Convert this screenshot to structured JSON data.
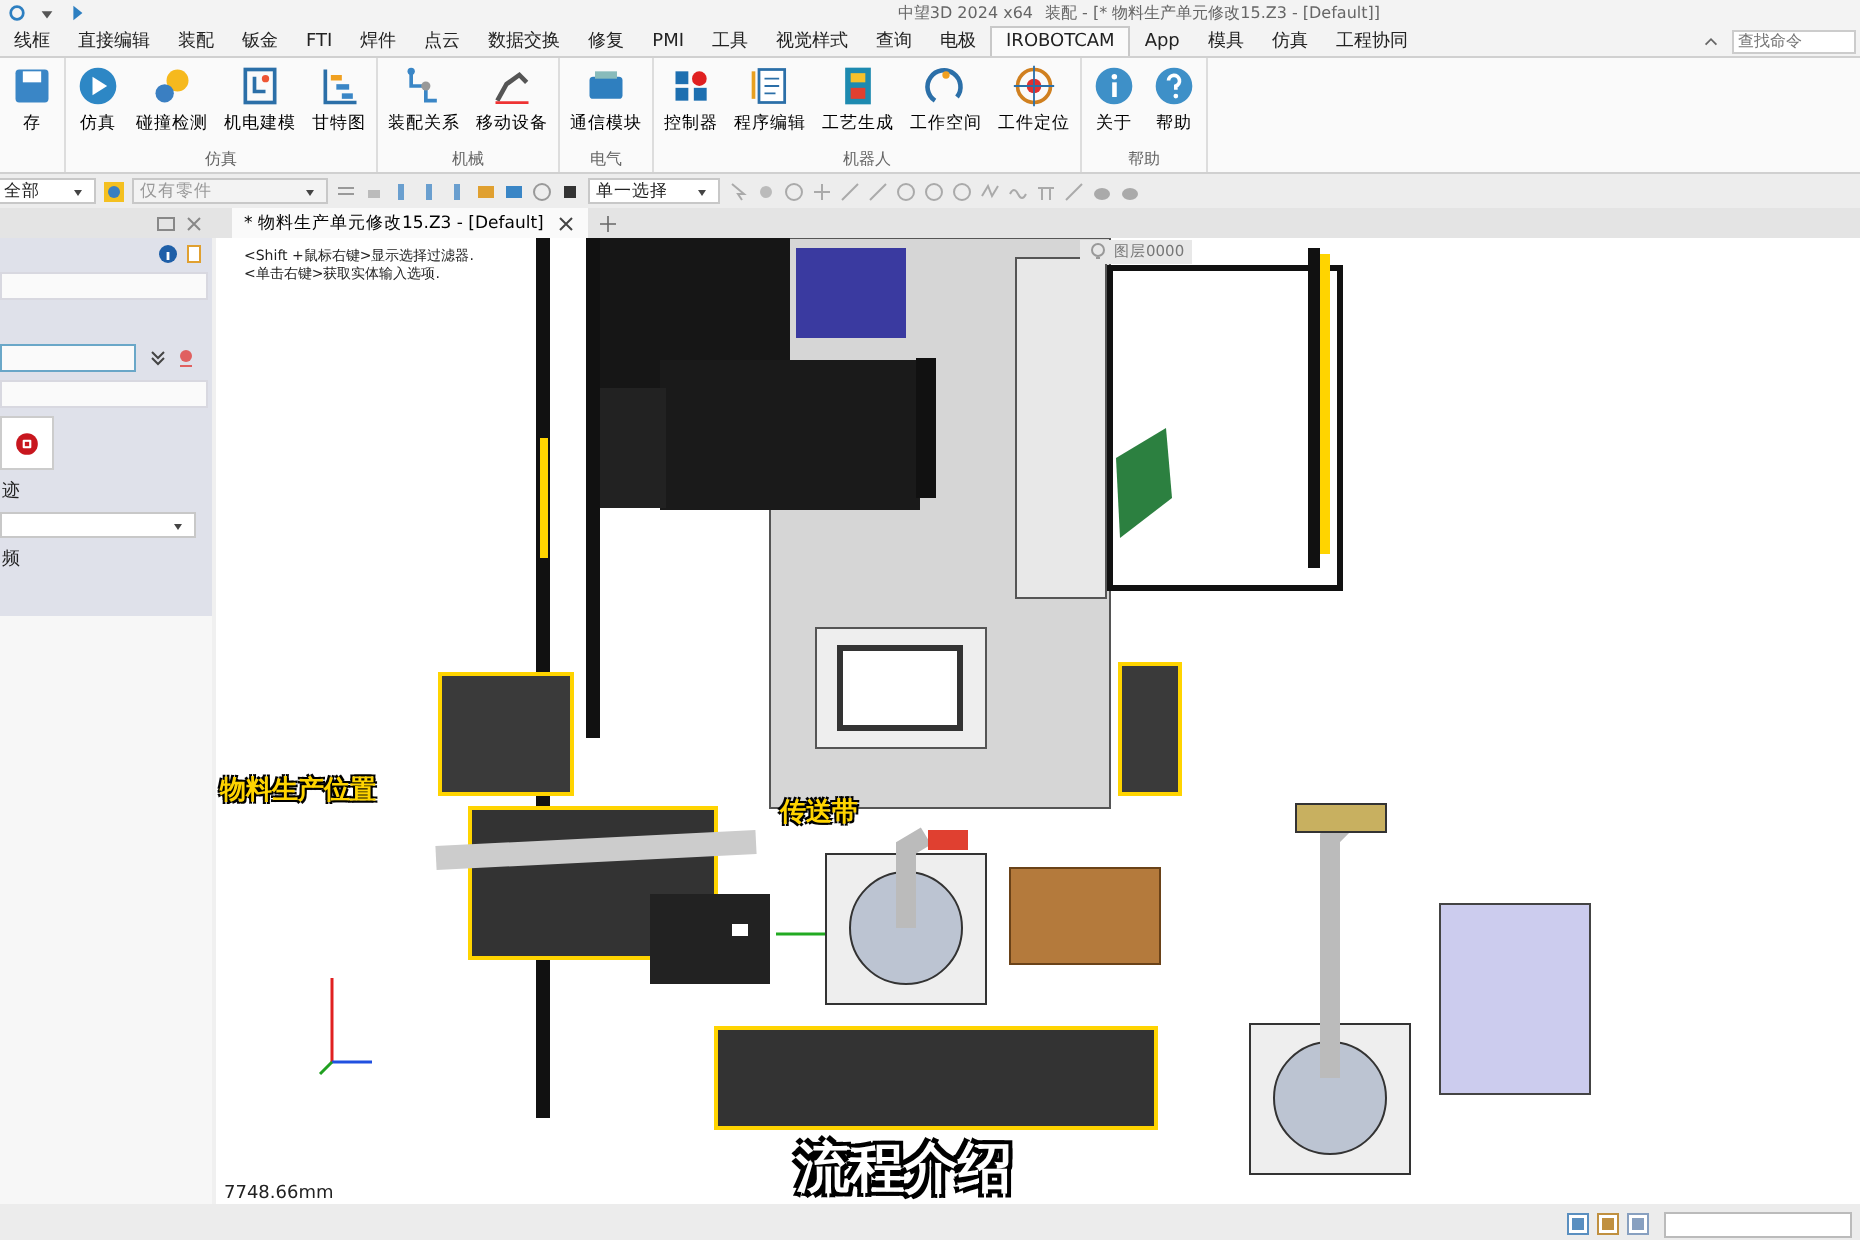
{
  "title_bar": {
    "app": "中望3D 2024 x64",
    "document": "装配 - [* 物料生产单元修改15.Z3 - [Default]]"
  },
  "menu_tabs": [
    {
      "label": "线框",
      "selected": false
    },
    {
      "label": "直接编辑",
      "selected": false
    },
    {
      "label": "装配",
      "selected": false
    },
    {
      "label": "钣金",
      "selected": false
    },
    {
      "label": "FTI",
      "selected": false
    },
    {
      "label": "焊件",
      "selected": false
    },
    {
      "label": "点云",
      "selected": false
    },
    {
      "label": "数据交换",
      "selected": false
    },
    {
      "label": "修复",
      "selected": false
    },
    {
      "label": "PMI",
      "selected": false
    },
    {
      "label": "工具",
      "selected": false
    },
    {
      "label": "视觉样式",
      "selected": false
    },
    {
      "label": "查询",
      "selected": false
    },
    {
      "label": "电极",
      "selected": false
    },
    {
      "label": "IROBOTCAM",
      "selected": true
    },
    {
      "label": "App",
      "selected": false
    },
    {
      "label": "模具",
      "selected": false
    },
    {
      "label": "仿真",
      "selected": false
    },
    {
      "label": "工程协同",
      "selected": false
    }
  ],
  "search": {
    "placeholder": "查找命令"
  },
  "ribbon": [
    {
      "items": [
        "存"
      ]
    },
    {
      "label": "仿真",
      "items": [
        "仿真",
        "碰撞检测",
        "机电建模",
        "甘特图"
      ]
    },
    {
      "label": "机械",
      "items": [
        "装配关系",
        "移动设备"
      ]
    },
    {
      "label": "电气",
      "items": [
        "通信模块"
      ]
    },
    {
      "label": "机器人",
      "items": [
        "控制器",
        "程序编辑",
        "工艺生成",
        "工作空间",
        "工件定位"
      ]
    },
    {
      "label": "帮助",
      "items": [
        "关于",
        "帮助"
      ]
    }
  ],
  "toolbar": {
    "filter": "全部",
    "parts": "仅有零件",
    "selection": "单一选择"
  },
  "document_tabs": [
    {
      "label": "* 物料生产单元修改15.Z3 - [Default]",
      "selected": true
    }
  ],
  "side_panel": {
    "texts": [
      "迹",
      "频"
    ]
  },
  "viewport": {
    "hints": [
      "<Shift +鼠标右键>显示选择过滤器.",
      "<单击右键>获取实体输入选项."
    ],
    "layer": "图层0000",
    "labels": [
      "物料生产位置",
      "传送带"
    ],
    "scale": "7748.66mm",
    "caption": "流程介绍"
  }
}
